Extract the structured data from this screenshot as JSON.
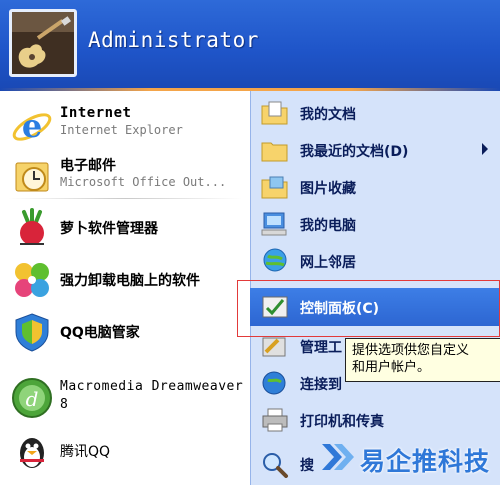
{
  "user": {
    "name": "Administrator"
  },
  "left_items": [
    {
      "id": "internet",
      "title": "Internet",
      "subtitle": "Internet Explorer",
      "icon": "internet-explorer-icon"
    },
    {
      "id": "email",
      "title": "电子邮件",
      "subtitle": "Microsoft Office Out...",
      "icon": "outlook-icon"
    },
    {
      "id": "luobo",
      "title": "萝卜软件管理器",
      "icon": "radish-icon"
    },
    {
      "id": "uninstall",
      "title": "强力卸载电脑上的软件",
      "icon": "pinwheel-icon"
    },
    {
      "id": "qqpcmgr",
      "title": "QQ电脑管家",
      "icon": "shield-icon"
    },
    {
      "id": "dreamweaver",
      "title": "Macromedia Dreamweaver",
      "subtitle": "8",
      "icon": "dreamweaver-icon"
    },
    {
      "id": "qq",
      "title": "腾讯QQ",
      "icon": "qq-penguin-icon"
    }
  ],
  "right_items": [
    {
      "id": "my-documents",
      "label": "我的文档",
      "icon": "folder-documents-icon"
    },
    {
      "id": "recent-documents",
      "label": "我最近的文档(D)",
      "icon": "folder-icon",
      "submenu": true
    },
    {
      "id": "my-pictures",
      "label": "图片收藏",
      "icon": "folder-pictures-icon"
    },
    {
      "id": "my-computer",
      "label": "我的电脑",
      "icon": "computer-icon"
    },
    {
      "id": "network",
      "label": "网上邻居",
      "icon": "network-icon"
    },
    {
      "id": "control-panel",
      "label": "控制面板(C)",
      "icon": "control-panel-icon",
      "highlighted": true
    },
    {
      "id": "manage-tools",
      "label": "管理工",
      "icon": "admin-tools-icon"
    },
    {
      "id": "connect-to",
      "label": "连接到",
      "icon": "connect-icon"
    },
    {
      "id": "printers",
      "label": "打印机和传真",
      "icon": "printer-icon"
    },
    {
      "id": "search",
      "label": "搜",
      "icon": "search-icon"
    }
  ],
  "tooltip": {
    "line1": "提供选项供您自定义",
    "line2": "和用户帐户。"
  },
  "watermark": {
    "text": "易企推科技"
  },
  "colors": {
    "header": "#1f55c9",
    "highlight": "#316ac5",
    "right_panel": "#d5e3fa",
    "red_box": "#e23a3a"
  }
}
